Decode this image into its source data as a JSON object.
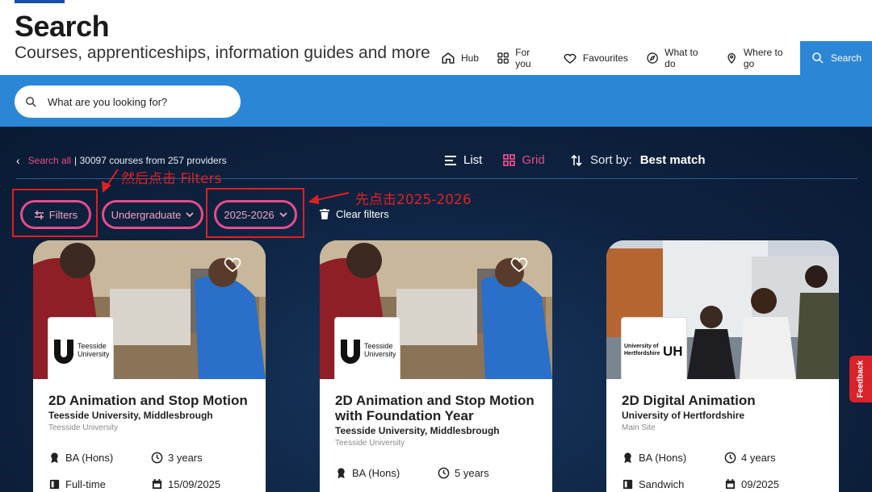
{
  "header": {
    "title": "Search",
    "subtitle": "Courses, apprenticeships, information guides and more",
    "nav": [
      {
        "label": "Hub",
        "icon": "home-icon"
      },
      {
        "label": "For you",
        "icon": "grid-icon"
      },
      {
        "label": "Favourites",
        "icon": "heart-icon"
      },
      {
        "label": "What to do",
        "icon": "compass-icon"
      },
      {
        "label": "Where to go",
        "icon": "map-pin-icon"
      },
      {
        "label": "Search",
        "icon": "search-icon",
        "active": true
      }
    ]
  },
  "search": {
    "placeholder": "What are you looking for?"
  },
  "results": {
    "back_label": "Search all",
    "count_text": "| 30097 courses from 257 providers",
    "list_label": "List",
    "grid_label": "Grid",
    "sort_label": "Sort by:",
    "sort_value": "Best match"
  },
  "filters": {
    "filters_label": "Filters",
    "level_label": "Undergraduate",
    "year_label": "2025-2026",
    "clear_label": "Clear filters"
  },
  "annotations": {
    "note_filters": "然后点击 Filters",
    "note_year": "先点击2025-2026"
  },
  "cards": [
    {
      "title_lines": [
        "2D Animation and Stop Motion"
      ],
      "provider": "Teesside University, Middlesbrough",
      "campus": "Teesside University",
      "logo_text": [
        "Teesside",
        "University"
      ],
      "qualification": "BA (Hons)",
      "duration": "3 years",
      "mode": "Full-time",
      "start": "15/09/2025"
    },
    {
      "title_lines": [
        "2D Animation and Stop Motion",
        "with Foundation Year"
      ],
      "provider": "Teesside University, Middlesbrough",
      "campus": "Teesside University",
      "logo_text": [
        "Teesside",
        "University"
      ],
      "qualification": "BA (Hons)",
      "duration": "5 years"
    },
    {
      "title_lines": [
        "2D Digital Animation"
      ],
      "provider": "University of Hertfordshire",
      "campus": "Main Site",
      "logo_text": [
        "University of",
        "Hertfordshire",
        "UH"
      ],
      "qualification": "BA (Hons)",
      "duration": "4 years",
      "mode": "Sandwich",
      "start": "09/2025"
    }
  ],
  "feedback_label": "Feedback",
  "colors": {
    "accent_pink": "#e84c8a",
    "nav_blue": "#2b86d6",
    "dark_bg": "#0e2240",
    "annotation_red": "#e02020"
  }
}
